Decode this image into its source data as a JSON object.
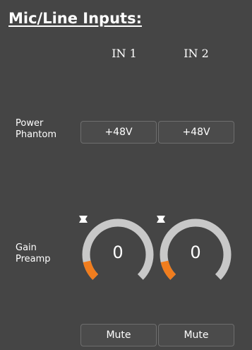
{
  "title": "Mic/Line Inputs:",
  "channels": [
    {
      "label": "IN 1",
      "phantom_label": "+48V",
      "gain_value": "0",
      "gain_fraction": 0.12,
      "mute_label": "Mute"
    },
    {
      "label": "IN 2",
      "phantom_label": "+48V",
      "gain_value": "0",
      "gain_fraction": 0.12,
      "mute_label": "Mute"
    }
  ],
  "rows": {
    "phantom": [
      "Power",
      "Phantom"
    ],
    "gain": [
      "Gain",
      "Preamp"
    ]
  },
  "colors": {
    "background": "#454545",
    "knob_track": "#c8c8c8",
    "knob_fill": "#f07d1e",
    "button_border": "#6e6e6e"
  },
  "icons": {
    "increase": "chevron-up-icon",
    "decrease": "chevron-down-icon"
  }
}
